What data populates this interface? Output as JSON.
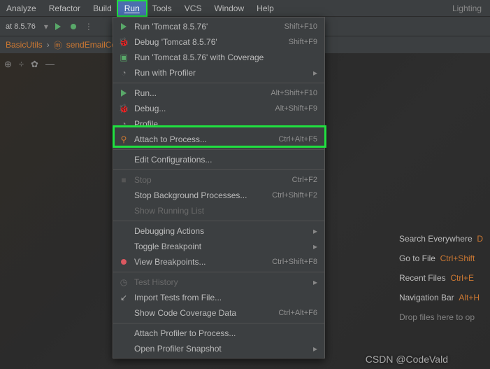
{
  "menubar": {
    "items": [
      "Analyze",
      "Refactor",
      "Build",
      "Run",
      "Tools",
      "VCS",
      "Window",
      "Help"
    ],
    "app": "Lighting"
  },
  "toolbar": {
    "config": "at 8.5.76"
  },
  "breadcrumb": {
    "class": "BasicUtils",
    "method": "sendEmailCo"
  },
  "dropdown": {
    "run": "Run 'Tomcat 8.5.76'",
    "run_sc": "Shift+F10",
    "debug": "Debug 'Tomcat 8.5.76'",
    "debug_sc": "Shift+F9",
    "coverage": "Run 'Tomcat 8.5.76' with Coverage",
    "profiler": "Run with Profiler",
    "run2": "Run...",
    "run2_sc": "Alt+Shift+F10",
    "debug2": "Debug...",
    "debug2_sc": "Alt+Shift+F9",
    "profile": "Profile...",
    "attach": "Attach to Process...",
    "attach_sc": "Ctrl+Alt+F5",
    "edit": "Edit Configurations...",
    "stop": "Stop",
    "stop_sc": "Ctrl+F2",
    "stopbg": "Stop Background Processes...",
    "stopbg_sc": "Ctrl+Shift+F2",
    "running": "Show Running List",
    "dbgact": "Debugging Actions",
    "toggle": "Toggle Breakpoint",
    "viewbp": "View Breakpoints...",
    "viewbp_sc": "Ctrl+Shift+F8",
    "history": "Test History",
    "import": "Import Tests from File...",
    "covdata": "Show Code Coverage Data",
    "covdata_sc": "Ctrl+Alt+F6",
    "attprof": "Attach Profiler to Process...",
    "opensnap": "Open Profiler Snapshot"
  },
  "tips": {
    "t1": "Search Everywhere",
    "k1": "D",
    "t2": "Go to File",
    "k2": "Ctrl+Shift",
    "t3": "Recent Files",
    "k3": "Ctrl+E",
    "t4": "Navigation Bar",
    "k4": "Alt+H",
    "t5": "Drop files here to op"
  },
  "watermark": "CSDN @CodeVald"
}
